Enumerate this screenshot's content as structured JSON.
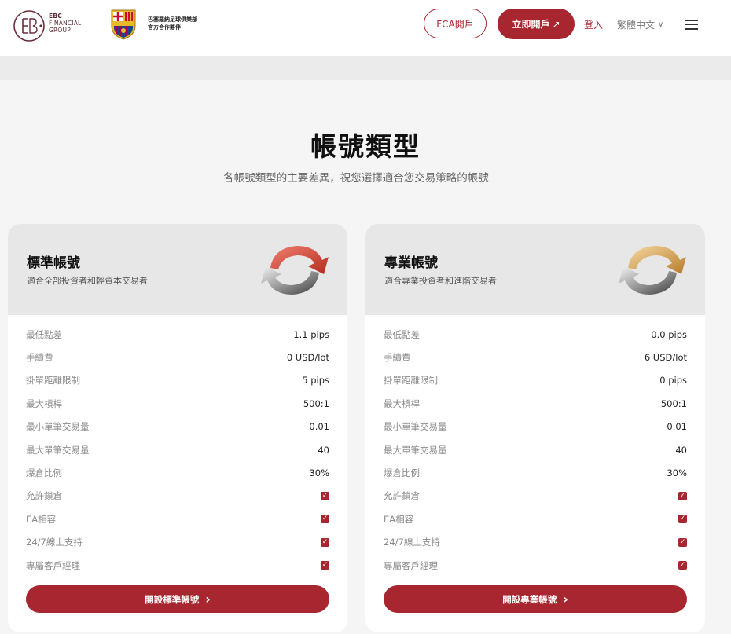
{
  "header": {
    "brand_lines": [
      "EBC",
      "FINANCIAL",
      "GROUP"
    ],
    "partner_lines": [
      "巴塞羅納足球俱樂部",
      "官方合作夥伴"
    ],
    "fca_label": "FCA開戶",
    "open_label": "立即開戶",
    "open_arrow": "↗",
    "login_label": "登入",
    "language_label": "繁體中文",
    "language_chevron": "∨"
  },
  "main": {
    "title": "帳號類型",
    "subtitle": "各帳號類型的主要差異，祝您選擇適合您交易策略的帳號"
  },
  "colors": {
    "accent": "#a8262f",
    "gold": "#d9a25a",
    "red_arrow": "#d2452f"
  },
  "accounts": [
    {
      "name": "標準帳號",
      "description": "適合全部投資者和輕資本交易者",
      "icon": "red-silver-cycle-arrows-icon",
      "rows": [
        {
          "label": "最低點差",
          "value": "1.1 pips"
        },
        {
          "label": "手續費",
          "value": "0 USD/lot"
        },
        {
          "label": "掛單距離限制",
          "value": "5 pips"
        },
        {
          "label": "最大槓桿",
          "value": "500:1"
        },
        {
          "label": "最小單筆交易量",
          "value": "0.01"
        },
        {
          "label": "最大單筆交易量",
          "value": "40"
        },
        {
          "label": "爆倉比例",
          "value": "30%"
        }
      ],
      "features": [
        {
          "label": "允許鎖倉",
          "checked": true
        },
        {
          "label": "EA相容",
          "checked": true
        },
        {
          "label": "24/7線上支持",
          "checked": true
        },
        {
          "label": "專屬客戶經理",
          "checked": true
        }
      ],
      "button_label": "開設標準帳號",
      "button_chevron": "›"
    },
    {
      "name": "專業帳號",
      "description": "適合專業投資者和進階交易者",
      "icon": "gold-silver-cycle-arrows-icon",
      "rows": [
        {
          "label": "最低點差",
          "value": "0.0 pips"
        },
        {
          "label": "手續費",
          "value": "6 USD/lot"
        },
        {
          "label": "掛單距離限制",
          "value": "0 pips"
        },
        {
          "label": "最大槓桿",
          "value": "500:1"
        },
        {
          "label": "最小單筆交易量",
          "value": "0.01"
        },
        {
          "label": "最大單筆交易量",
          "value": "40"
        },
        {
          "label": "爆倉比例",
          "value": "30%"
        }
      ],
      "features": [
        {
          "label": "允許鎖倉",
          "checked": true
        },
        {
          "label": "EA相容",
          "checked": true
        },
        {
          "label": "24/7線上支持",
          "checked": true
        },
        {
          "label": "專屬客戶經理",
          "checked": true
        }
      ],
      "button_label": "開設專業帳號",
      "button_chevron": "›"
    }
  ]
}
